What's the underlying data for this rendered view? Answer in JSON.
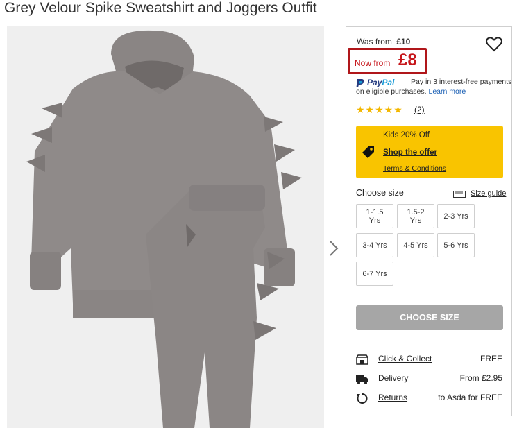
{
  "product": {
    "title": "Grey Velour Spike Sweatshirt and Joggers Outfit",
    "image_alt": "Grey velour hooded sweatshirt and joggers with spikes"
  },
  "price": {
    "was_label": "Was from",
    "was_value": "£10",
    "now_label": "Now from",
    "now_value": "£8",
    "highlight_color": "#b0161a"
  },
  "paypal": {
    "brand_pay": "Pay",
    "brand_pal": "Pal",
    "line1": "Pay in 3 interest-free payments",
    "line2": "on eligible purchases.",
    "learn_more": "Learn more"
  },
  "rating": {
    "stars": "★★★★★",
    "value": 5,
    "count": "(2)"
  },
  "offer": {
    "title": "Kids 20% Off",
    "link": "Shop the offer",
    "terms": "Terms & Conditions",
    "bg_color": "#f9c400"
  },
  "sizes": {
    "label": "Choose size",
    "guide": "Size guide",
    "options": [
      "1-1.5 Yrs",
      "1.5-2 Yrs",
      "2-3 Yrs",
      "3-4 Yrs",
      "4-5 Yrs",
      "5-6 Yrs",
      "6-7 Yrs"
    ]
  },
  "cta": {
    "label": "CHOOSE SIZE"
  },
  "delivery": [
    {
      "icon": "click-collect-icon",
      "label": "Click & Collect",
      "value": "FREE"
    },
    {
      "icon": "delivery-truck-icon",
      "label": "Delivery",
      "value": "From £2.95"
    },
    {
      "icon": "returns-icon",
      "label": "Returns",
      "value": "to Asda for FREE"
    }
  ]
}
